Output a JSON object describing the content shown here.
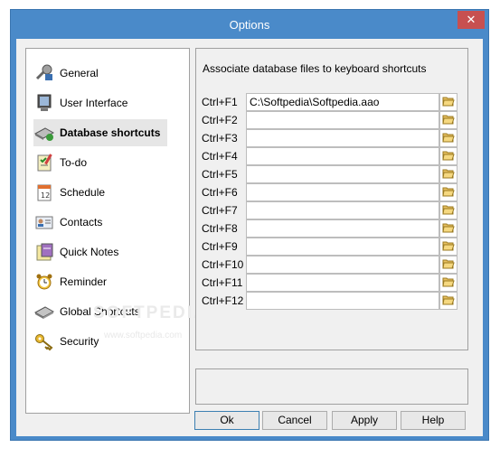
{
  "window": {
    "title": "Options",
    "close_symbol": "✕"
  },
  "sidebar": {
    "items": [
      {
        "label": "General",
        "icon": "tools-icon"
      },
      {
        "label": "User Interface",
        "icon": "monitor-icon"
      },
      {
        "label": "Database shortcuts",
        "icon": "keyboard-icon",
        "selected": true
      },
      {
        "label": "To-do",
        "icon": "todo-icon"
      },
      {
        "label": "Schedule",
        "icon": "calendar-icon"
      },
      {
        "label": "Contacts",
        "icon": "contacts-icon"
      },
      {
        "label": "Quick Notes",
        "icon": "notes-icon"
      },
      {
        "label": "Reminder",
        "icon": "alarm-clock-icon"
      },
      {
        "label": "Global Shortcuts",
        "icon": "keyboard-icon"
      },
      {
        "label": "Security",
        "icon": "key-icon"
      }
    ]
  },
  "panel": {
    "heading": "Associate database files to keyboard shortcuts",
    "shortcuts": [
      {
        "key": "Ctrl+F1",
        "path": "C:\\Softpedia\\Softpedia.aao"
      },
      {
        "key": "Ctrl+F2",
        "path": ""
      },
      {
        "key": "Ctrl+F3",
        "path": ""
      },
      {
        "key": "Ctrl+F4",
        "path": ""
      },
      {
        "key": "Ctrl+F5",
        "path": ""
      },
      {
        "key": "Ctrl+F6",
        "path": ""
      },
      {
        "key": "Ctrl+F7",
        "path": ""
      },
      {
        "key": "Ctrl+F8",
        "path": ""
      },
      {
        "key": "Ctrl+F9",
        "path": ""
      },
      {
        "key": "Ctrl+F10",
        "path": ""
      },
      {
        "key": "Ctrl+F11",
        "path": ""
      },
      {
        "key": "Ctrl+F12",
        "path": ""
      }
    ]
  },
  "buttons": {
    "ok": "Ok",
    "cancel": "Cancel",
    "apply": "Apply",
    "help": "Help"
  },
  "watermark": {
    "text": "SOFTPEDIA",
    "sub": "www.softpedia.com"
  },
  "colors": {
    "titlebar": "#4a8ac9",
    "close": "#c75050",
    "dialog": "#f0f0f0"
  }
}
